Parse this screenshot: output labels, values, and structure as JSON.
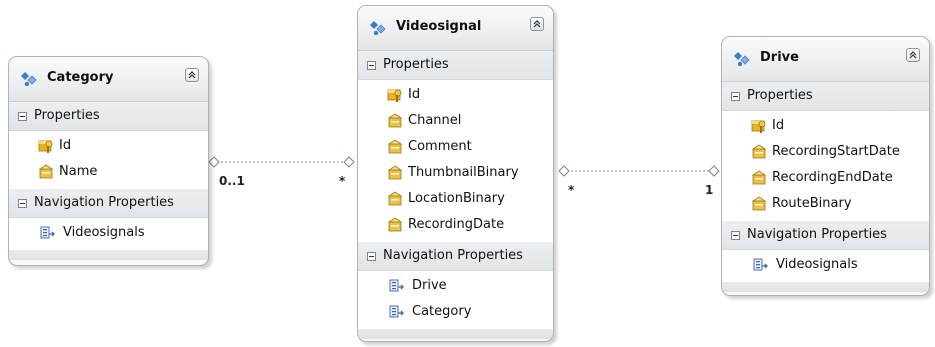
{
  "entities": {
    "category": {
      "name": "Category",
      "properties_label": "Properties",
      "properties": [
        "Id",
        "Name"
      ],
      "navigation_label": "Navigation Properties",
      "navigation": [
        "Videosignals"
      ]
    },
    "videosignal": {
      "name": "Videosignal",
      "properties_label": "Properties",
      "properties": [
        "Id",
        "Channel",
        "Comment",
        "ThumbnailBinary",
        "LocationBinary",
        "RecordingDate"
      ],
      "navigation_label": "Navigation Properties",
      "navigation": [
        "Drive",
        "Category"
      ]
    },
    "drive": {
      "name": "Drive",
      "properties_label": "Properties",
      "properties": [
        "Id",
        "RecordingStartDate",
        "RecordingEndDate",
        "RouteBinary"
      ],
      "navigation_label": "Navigation Properties",
      "navigation": [
        "Videosignals"
      ]
    }
  },
  "associations": [
    {
      "from": "category",
      "to": "videosignal",
      "from_mult": "0..1",
      "to_mult": "*"
    },
    {
      "from": "videosignal",
      "to": "drive",
      "from_mult": "*",
      "to_mult": "1"
    }
  ],
  "colors": {
    "connector": "#9aa3ab",
    "key_icon": "#e8b321",
    "property_icon": "#e9c04a",
    "navigation_icon": "#3b66a8",
    "entity_icon": "#3d7fc4"
  }
}
